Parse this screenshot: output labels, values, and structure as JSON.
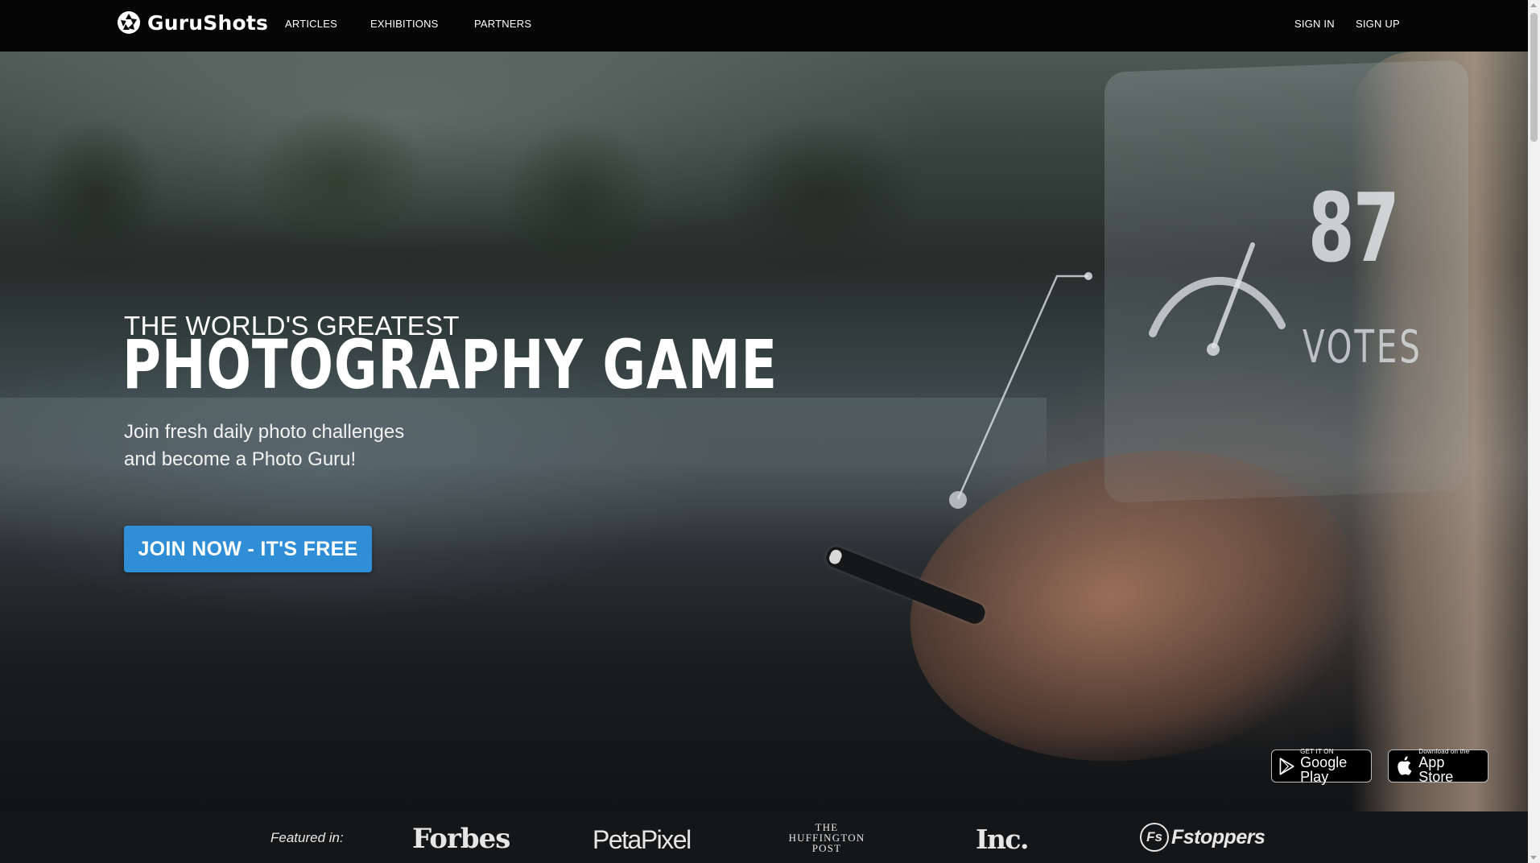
{
  "navbar": {
    "brand": "GuruShots",
    "links": [
      "ARTICLES",
      "EXHIBITIONS",
      "PARTNERS"
    ],
    "sign_in": "SIGN IN",
    "sign_up": "SIGN UP"
  },
  "hero": {
    "subtitle": "THE WORLD'S GREATEST",
    "title": "PHOTOGRAPHY GAME",
    "description_lines": [
      "Join fresh daily photo challenges",
      "and become a Photo Guru!"
    ],
    "cta_label": "JOIN NOW - IT'S FREE",
    "cta_color": "#2f8ed6",
    "overlay": {
      "votes_number": "87",
      "votes_label": "VOTES"
    },
    "store_badges": {
      "google": {
        "small": "GET IT ON",
        "big": "Google Play",
        "icon": "google-play-icon"
      },
      "apple": {
        "small": "Download on the",
        "big": "App Store",
        "icon": "apple-icon"
      }
    }
  },
  "featured": {
    "label": "Featured in:",
    "logos": {
      "forbes": "Forbes",
      "petapixel": "PetaPixel",
      "huffington": [
        "THE",
        "HUFFINGTON",
        "POST"
      ],
      "inc": "Inc.",
      "fstoppers_mark": "Fs",
      "fstoppers": "Fstoppers"
    }
  }
}
